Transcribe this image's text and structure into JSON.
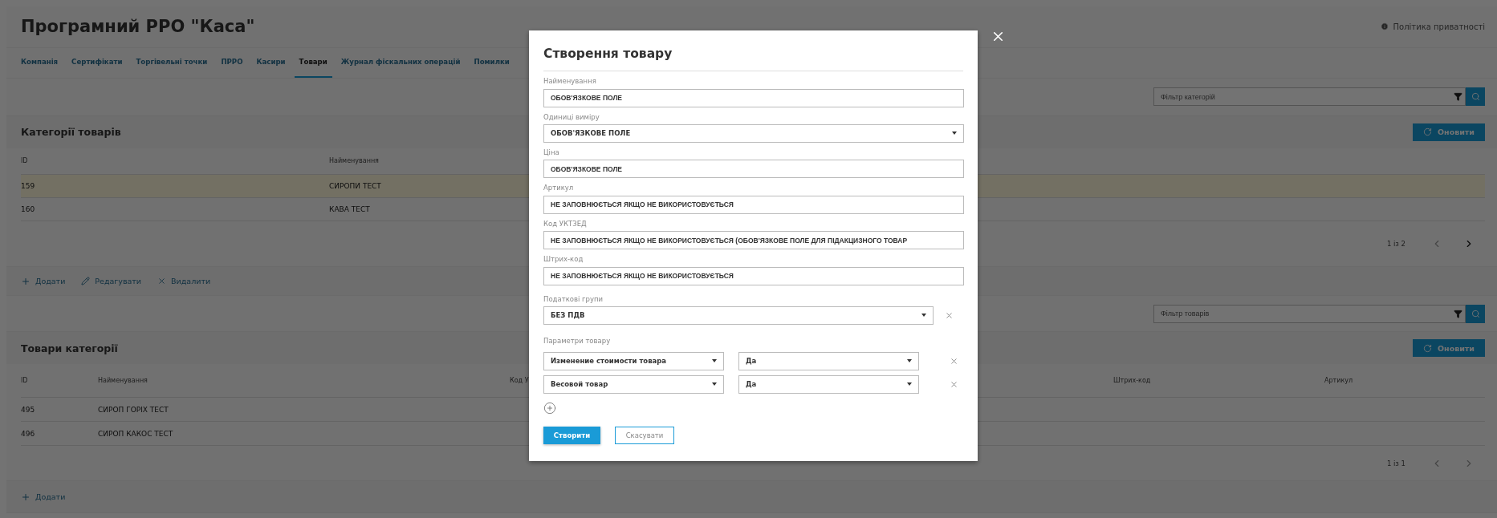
{
  "header": {
    "title": "Програмний РРО \"Каса\"",
    "privacy_link": "Політика приватності"
  },
  "tabs": [
    {
      "label": "Компанія",
      "selected": false
    },
    {
      "label": "Сертифікати",
      "selected": false
    },
    {
      "label": "Торгівельні точки",
      "selected": false
    },
    {
      "label": "ПРРО",
      "selected": false
    },
    {
      "label": "Касири",
      "selected": false
    },
    {
      "label": "Товари",
      "selected": true
    },
    {
      "label": "Журнал фіскальних операцій",
      "selected": false
    },
    {
      "label": "Помилки",
      "selected": false
    }
  ],
  "categories": {
    "filter_placeholder": "Фільтр категорій",
    "title": "Категорії товарів",
    "refresh": "Оновити",
    "columns": [
      "ID",
      "Найменування"
    ],
    "rows": [
      {
        "cells": [
          "159",
          "СИРОПИ ТЕСТ"
        ],
        "selected": true
      },
      {
        "cells": [
          "160",
          "КАВА ТЕСТ"
        ],
        "selected": false
      }
    ],
    "pagination": {
      "label": "1 із 2",
      "prev_disabled": true,
      "next_disabled": false
    },
    "actions": [
      {
        "label": "Додати",
        "kind": "add"
      },
      {
        "label": "Редагувати",
        "kind": "edit"
      },
      {
        "label": "Видалити",
        "kind": "delete"
      }
    ]
  },
  "products": {
    "filter_placeholder": "Фільтр товарів",
    "title": "Товари категорії",
    "refresh": "Оновити",
    "columns": [
      "ID",
      "Найменування",
      "Код У",
      "Штрих-код",
      "Артикул"
    ],
    "rows": [
      {
        "cells": [
          "495",
          "СИРОП ГОРІХ ТЕСТ"
        ],
        "selected": false
      },
      {
        "cells": [
          "496",
          "СИРОП КАКОС ТЕСТ"
        ],
        "selected": false
      }
    ],
    "pagination": {
      "label": "1 із 1",
      "prev_disabled": true,
      "next_disabled": true
    },
    "actions": [
      {
        "label": "Додати",
        "kind": "add"
      }
    ]
  },
  "modal": {
    "title": "Створення товару",
    "fields": [
      {
        "label": "Найменування",
        "kind": "input",
        "placeholder": "ОБОВ'ЯЗКОВЕ ПОЛЕ"
      },
      {
        "label": "Одиниці виміру",
        "kind": "select",
        "value": "ОБОВ'ЯЗКОВЕ ПОЛЕ"
      },
      {
        "label": "Ціна",
        "kind": "input",
        "placeholder": "ОБОВ'ЯЗКОВЕ ПОЛЕ"
      },
      {
        "label": "Артикул",
        "kind": "input",
        "placeholder": "НЕ ЗАПОВНЮЄТЬСЯ ЯКЩО НЕ ВИКОРИСТОВУЄТЬСЯ"
      },
      {
        "label": "Код УКТЗЕД",
        "kind": "input",
        "placeholder": "НЕ ЗАПОВНЮЄТЬСЯ ЯКЩО НЕ ВИКОРИСТОВУЄТЬСЯ (ОБОВ'ЯЗКОВЕ ПОЛЕ ДЛЯ ПІДАКЦИЗНОГО ТОВАР"
      },
      {
        "label": "Штрих-код",
        "kind": "input",
        "placeholder": "НЕ ЗАПОВНЮЄТЬСЯ ЯКЩО НЕ ВИКОРИСТОВУЄТЬСЯ"
      }
    ],
    "tax_groups": {
      "label": "Податкові групи",
      "value": "БЕЗ ПДВ"
    },
    "params": {
      "label": "Параметри товару",
      "rows": [
        {
          "name": "Изменение стоимости товара",
          "value": "Да"
        },
        {
          "name": "Весовой товар",
          "value": "Да"
        }
      ]
    },
    "submit": "Створити",
    "cancel": "Скасувати"
  }
}
